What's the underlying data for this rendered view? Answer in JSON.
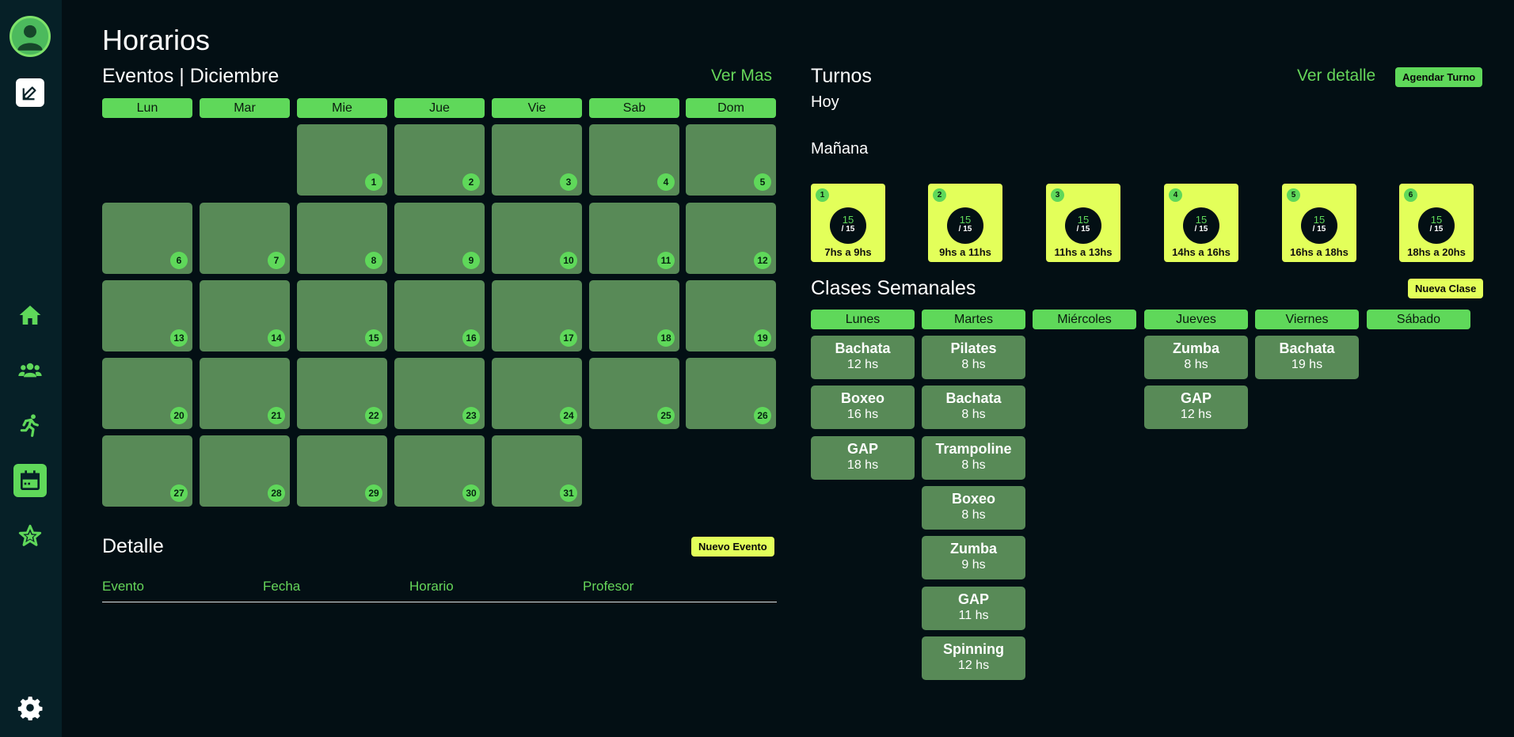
{
  "page": {
    "title": "Horarios"
  },
  "eventos": {
    "title": "Eventos | Diciembre",
    "ver_mas": "Ver Mas",
    "weekdays": [
      "Lun",
      "Mar",
      "Mie",
      "Jue",
      "Vie",
      "Sab",
      "Dom"
    ],
    "days": [
      "1",
      "2",
      "3",
      "4",
      "5",
      "6",
      "7",
      "8",
      "9",
      "10",
      "11",
      "12",
      "13",
      "14",
      "15",
      "16",
      "17",
      "18",
      "19",
      "20",
      "21",
      "22",
      "23",
      "24",
      "25",
      "26",
      "27",
      "28",
      "29",
      "30",
      "31"
    ]
  },
  "detalle": {
    "title": "Detalle",
    "nuevo_evento": "Nuevo Evento",
    "columns": [
      "Evento",
      "Fecha",
      "Horario",
      "Profesor"
    ]
  },
  "turnos": {
    "title": "Turnos",
    "ver_detalle": "Ver detalle",
    "agendar": "Agendar Turno",
    "hoy": "Hoy",
    "manana": "Mañana",
    "slots": [
      {
        "idx": "1",
        "current": "15",
        "total": "/ 15",
        "time": "7hs a 9hs"
      },
      {
        "idx": "2",
        "current": "15",
        "total": "/ 15",
        "time": "9hs a 11hs"
      },
      {
        "idx": "3",
        "current": "15",
        "total": "/ 15",
        "time": "11hs a 13hs"
      },
      {
        "idx": "4",
        "current": "15",
        "total": "/ 15",
        "time": "14hs a 16hs"
      },
      {
        "idx": "5",
        "current": "15",
        "total": "/ 15",
        "time": "16hs a 18hs"
      },
      {
        "idx": "6",
        "current": "15",
        "total": "/ 15",
        "time": "18hs a 20hs"
      }
    ]
  },
  "clases": {
    "title": "Clases Semanales",
    "nueva_clase": "Nueva Clase",
    "days": [
      {
        "name": "Lunes",
        "classes": [
          {
            "name": "Bachata",
            "hour": "12 hs"
          },
          {
            "name": "Boxeo",
            "hour": "16 hs"
          },
          {
            "name": "GAP",
            "hour": "18 hs"
          }
        ]
      },
      {
        "name": "Martes",
        "classes": [
          {
            "name": "Pilates",
            "hour": "8 hs"
          },
          {
            "name": "Bachata",
            "hour": "8 hs"
          },
          {
            "name": "Trampoline",
            "hour": "8 hs"
          },
          {
            "name": "Boxeo",
            "hour": "8 hs"
          },
          {
            "name": "Zumba",
            "hour": "9 hs"
          },
          {
            "name": "GAP",
            "hour": "11 hs"
          },
          {
            "name": "Spinning",
            "hour": "12 hs"
          }
        ]
      },
      {
        "name": "Miércoles",
        "classes": []
      },
      {
        "name": "Jueves",
        "classes": [
          {
            "name": "Zumba",
            "hour": "8 hs"
          },
          {
            "name": "GAP",
            "hour": "12 hs"
          }
        ]
      },
      {
        "name": "Viernes",
        "classes": [
          {
            "name": "Bachata",
            "hour": "19 hs"
          }
        ]
      },
      {
        "name": "Sábado",
        "classes": []
      }
    ]
  },
  "sidebar": {
    "icons": [
      "avatar",
      "edit-icon",
      "home-icon",
      "users-icon",
      "running-icon",
      "calendar-icon",
      "star-icon",
      "gear-icon"
    ],
    "active": "calendar-icon"
  },
  "colors": {
    "background": "#030f14",
    "sidebar": "#062027",
    "accent_green": "#5fd85a",
    "cell_green": "#588a57",
    "accent_yellow": "#e3ff5a"
  }
}
